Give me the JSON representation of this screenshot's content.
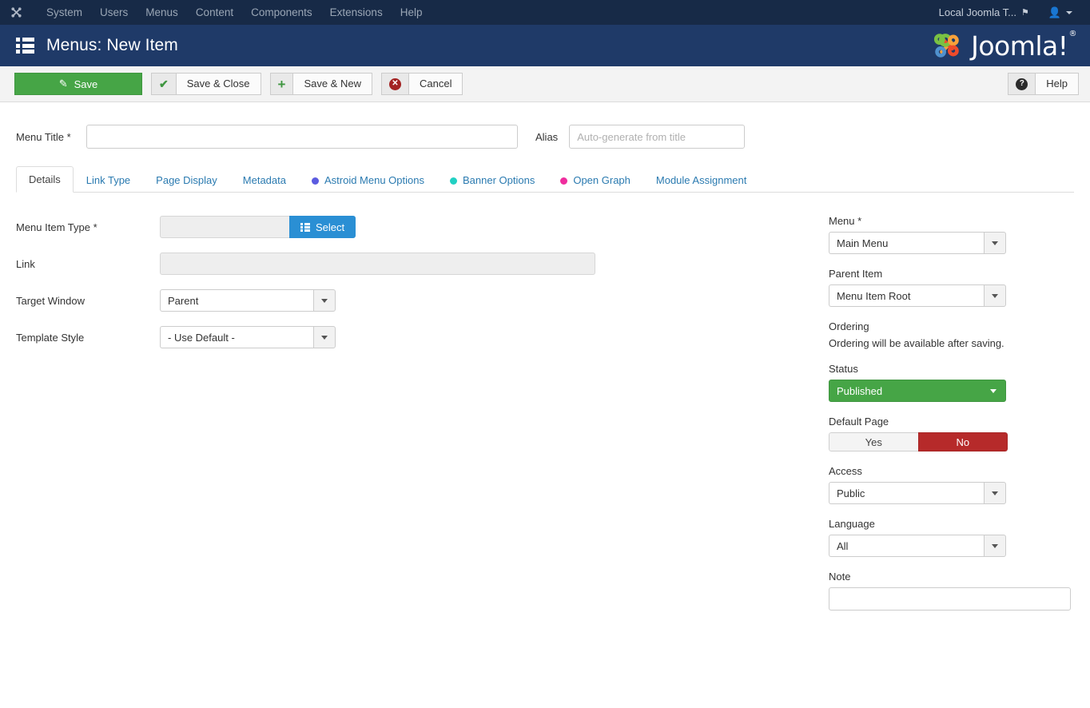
{
  "topbar": {
    "brand_icon": "joomla-mark-icon",
    "nav_items": [
      {
        "label": "System"
      },
      {
        "label": "Users"
      },
      {
        "label": "Menus"
      },
      {
        "label": "Content"
      },
      {
        "label": "Components"
      },
      {
        "label": "Extensions"
      },
      {
        "label": "Help"
      }
    ],
    "site_link_label": "Local Joomla T...",
    "site_link_icon": "external-link-icon",
    "user_icon": "user-icon",
    "user_caret_icon": "chevron-down-icon"
  },
  "subhead": {
    "icon": "menu-list-icon",
    "title": "Menus: New Item",
    "brand_name": "Joomla!",
    "brand_registered": "®",
    "brand_logo_icon": "joomla-logo-icon"
  },
  "toolbar": {
    "save": {
      "label": "Save",
      "icon": "pencil-square-icon"
    },
    "save_close": {
      "label": "Save & Close",
      "icon": "check-icon"
    },
    "save_new": {
      "label": "Save & New",
      "icon": "plus-icon"
    },
    "cancel": {
      "label": "Cancel",
      "icon": "circle-x-icon"
    },
    "help": {
      "label": "Help",
      "icon": "circle-question-icon"
    }
  },
  "form": {
    "menu_title_label": "Menu Title *",
    "menu_title_value": "",
    "menu_title_placeholder": "",
    "alias_label": "Alias",
    "alias_value": "",
    "alias_placeholder": "Auto-generate from title"
  },
  "tabs": [
    {
      "label": "Details",
      "active": true,
      "dot": null
    },
    {
      "label": "Link Type",
      "active": false,
      "dot": null
    },
    {
      "label": "Page Display",
      "active": false,
      "dot": null
    },
    {
      "label": "Metadata",
      "active": false,
      "dot": null
    },
    {
      "label": "Astroid Menu Options",
      "active": false,
      "dot": "#5b5be0"
    },
    {
      "label": "Banner Options",
      "active": false,
      "dot": "#21d0c3"
    },
    {
      "label": "Open Graph",
      "active": false,
      "dot": "#ef2d9e"
    },
    {
      "label": "Module Assignment",
      "active": false,
      "dot": null
    }
  ],
  "details": {
    "menu_item_type_label": "Menu Item Type *",
    "menu_item_type_value": "",
    "select_button_label": "Select",
    "select_button_icon": "grid-list-icon",
    "link_label": "Link",
    "link_value": "",
    "target_window_label": "Target Window",
    "target_window_value": "Parent",
    "template_style_label": "Template Style",
    "template_style_value": "- Use Default -"
  },
  "sidebar": {
    "menu_label": "Menu *",
    "menu_value": "Main Menu",
    "parent_item_label": "Parent Item",
    "parent_item_value": "Menu Item Root",
    "ordering_label": "Ordering",
    "ordering_note": "Ordering will be available after saving.",
    "status_label": "Status",
    "status_value": "Published",
    "default_page_label": "Default Page",
    "default_page_yes": "Yes",
    "default_page_no": "No",
    "access_label": "Access",
    "access_value": "Public",
    "language_label": "Language",
    "language_value": "All",
    "note_label": "Note",
    "note_value": "",
    "note_placeholder": ""
  },
  "colors": {
    "topbar_bg": "#172a47",
    "subhead_bg": "#1f3a68",
    "toolbar_bg": "#f3f3f3",
    "save_green": "#46a546",
    "select_blue": "#2a8fd4",
    "status_green": "#46a546",
    "toggle_red": "#b62a2a",
    "link_blue": "#2a7ab0"
  }
}
